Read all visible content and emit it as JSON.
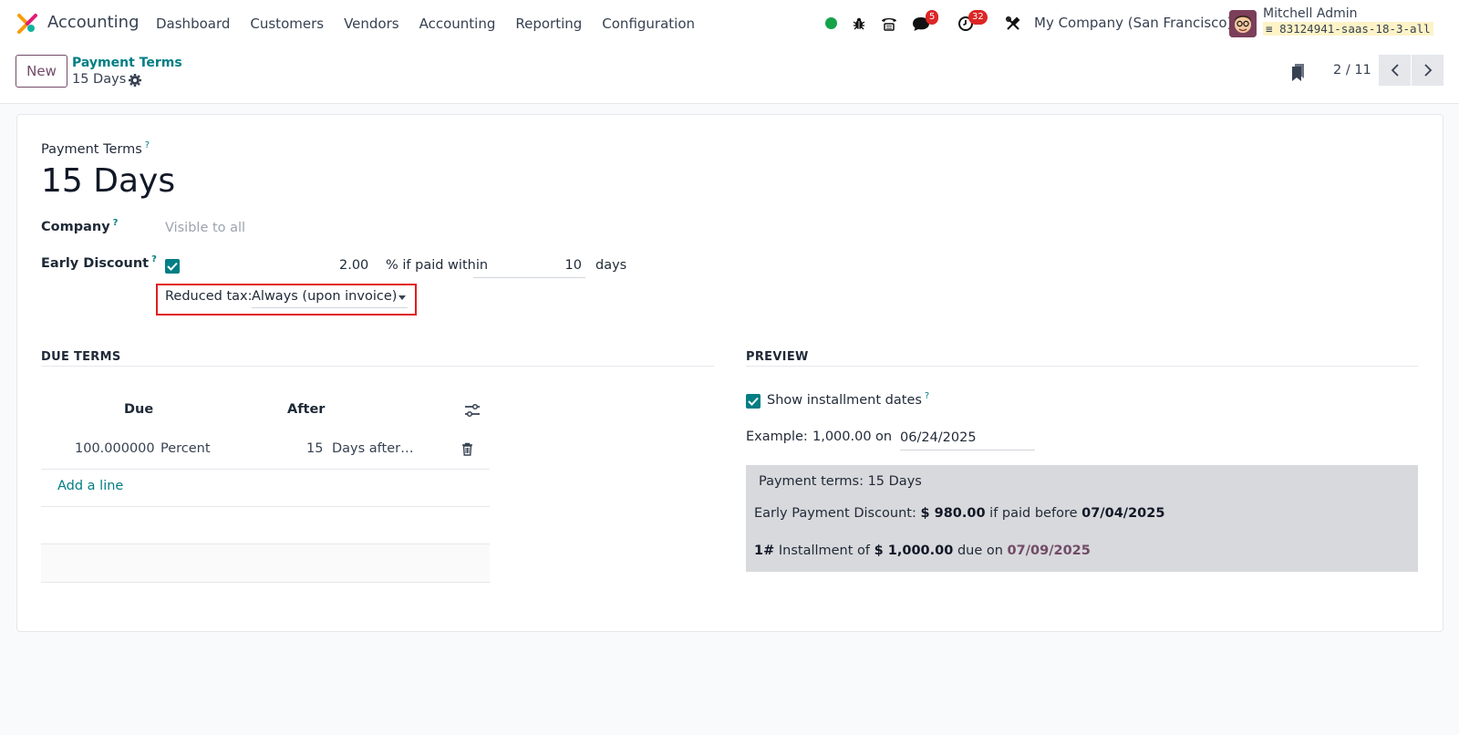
{
  "navbar": {
    "app_name": "Accounting",
    "menu": [
      "Dashboard",
      "Customers",
      "Vendors",
      "Accounting",
      "Reporting",
      "Configuration"
    ],
    "messages_badge": "5",
    "activities_badge": "32",
    "company": "My Company (San Francisco)",
    "user_name": "Mitchell Admin",
    "db_name": "83124941-saas-18-3-all",
    "status_color": "#16a34a"
  },
  "control": {
    "new_label": "New",
    "breadcrumb_parent": "Payment Terms",
    "breadcrumb_current": "15 Days",
    "pager": "2 / 11"
  },
  "form": {
    "name_label": "Payment Terms",
    "name_help": "?",
    "name_value": "15 Days",
    "company_label": "Company",
    "company_help": "?",
    "company_placeholder": "Visible to all",
    "early_discount_label": "Early Discount",
    "early_discount_help": "?",
    "early_discount_checked": true,
    "discount_percent": "2.00",
    "discount_text": "% if paid within",
    "discount_days": "10",
    "discount_days_unit": "days",
    "reduced_tax_label": "Reduced tax:",
    "reduced_tax_value": "Always (upon invoice)"
  },
  "due_terms": {
    "section_title": "DUE TERMS",
    "headers": {
      "due": "Due",
      "after": "After"
    },
    "rows": [
      {
        "value": "100.000000",
        "type": "Percent",
        "days": "15",
        "delay_type": "Days after…"
      }
    ],
    "add_line": "Add a line"
  },
  "preview": {
    "section_title": "PREVIEW",
    "show_dates_label": "Show installment dates",
    "show_dates_help": "?",
    "show_dates_checked": true,
    "example_label": "Example:",
    "example_amount": "1,000.00",
    "example_on": "on",
    "example_date": "06/24/2025",
    "terms_line_label": "Payment terms:",
    "terms_line_value": "15 Days",
    "discount_label": "Early Payment Discount:",
    "discount_amount": "$ 980.00",
    "discount_if": "if paid before",
    "discount_date": "07/04/2025",
    "installment_num": "1#",
    "installment_of": "Installment of",
    "installment_amount": "$ 1,000.00",
    "installment_due": "due on",
    "installment_date": "07/09/2025"
  },
  "colors": {
    "brand_purple": "#714b67",
    "teal": "#017e84",
    "highlight_red": "#e11d1d"
  }
}
